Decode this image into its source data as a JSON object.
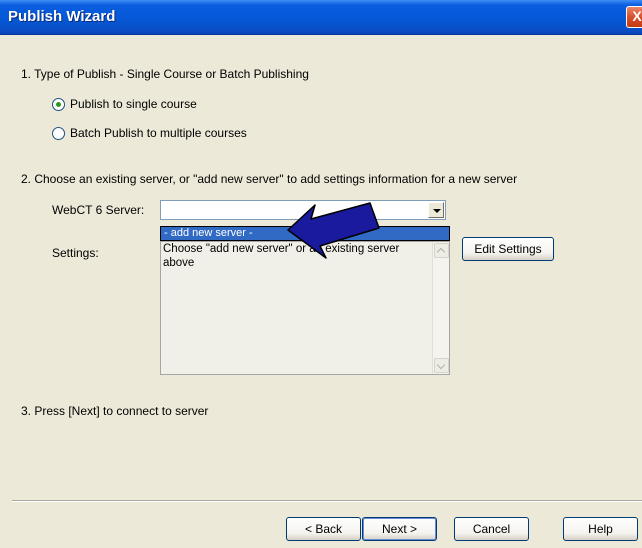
{
  "window": {
    "title": "Publish Wizard",
    "close_glyph": "X"
  },
  "step1": {
    "heading": "1.  Type of Publish - Single Course or Batch Publishing",
    "options": [
      {
        "label": "Publish to single course",
        "selected": true
      },
      {
        "label": "Batch Publish to multiple courses",
        "selected": false
      }
    ]
  },
  "step2": {
    "heading": "2.  Choose an existing server, or \"add new server\" to add settings information for a new server",
    "server_label": "WebCT 6 Server:",
    "server_value": "",
    "dropdown_item": "- add new server -",
    "settings_label": "Settings:",
    "settings_text": "Choose \"add new server\" or an existing server above",
    "edit_settings_button": "Edit Settings"
  },
  "step3": {
    "heading": "3.  Press [Next] to connect to server"
  },
  "footer": {
    "back_button": "< Back",
    "next_button": "Next >",
    "cancel_button": "Cancel",
    "help_button": "Help"
  },
  "colors": {
    "titlebar": "#0558d6",
    "selection": "#316ac5",
    "window_bg": "#ece9d8",
    "annotation_arrow": "#1a1a9e"
  }
}
